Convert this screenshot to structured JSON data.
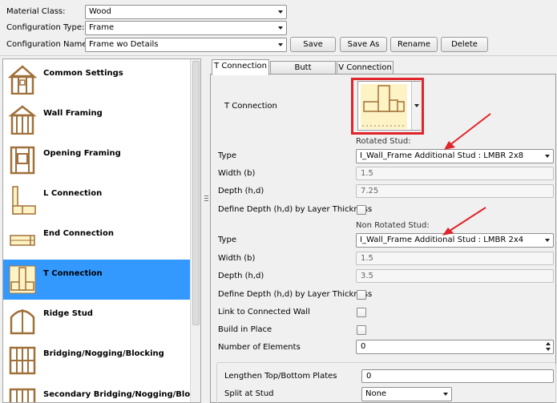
{
  "config": {
    "material_class_label": "Material Class:",
    "material_class_value": "Wood",
    "configuration_type_label": "Configuration Type:",
    "configuration_type_value": "Frame",
    "configuration_name_label": "Configuration Name:",
    "configuration_name_value": "Frame wo Details",
    "save_label": "Save",
    "save_as_label": "Save As",
    "rename_label": "Rename",
    "delete_label": "Delete"
  },
  "sidebar": {
    "items": [
      {
        "label": "Common Settings",
        "icon": "common-settings-icon"
      },
      {
        "label": "Wall Framing",
        "icon": "wall-framing-icon"
      },
      {
        "label": "Opening Framing",
        "icon": "opening-framing-icon"
      },
      {
        "label": "L Connection",
        "icon": "l-connection-icon"
      },
      {
        "label": "End Connection",
        "icon": "end-connection-icon"
      },
      {
        "label": "T Connection",
        "icon": "t-connection-icon",
        "selected": true
      },
      {
        "label": "Ridge Stud",
        "icon": "ridge-stud-icon"
      },
      {
        "label": "Bridging/Nogging/Blocking",
        "icon": "bridging-icon"
      },
      {
        "label": "Secondary Bridging/Nogging/Blocking",
        "icon": "secondary-bridging-icon"
      }
    ]
  },
  "tabs": [
    "T Connection",
    "Butt Connection",
    "V Connection"
  ],
  "panel": {
    "t_connection_label": "T Connection",
    "rotated_stud_heading": "Rotated Stud:",
    "rotated": {
      "type_label": "Type",
      "type_value": "I_Wall_Frame Additional Stud : LMBR 2x8",
      "width_label": "Width (b)",
      "width_value": "1.5",
      "depth_label": "Depth (h,d)",
      "depth_value": "7.25",
      "define_depth_label": "Define Depth (h,d) by Layer Thickness"
    },
    "non_rotated_stud_heading": "Non Rotated Stud:",
    "non_rotated": {
      "type_label": "Type",
      "type_value": "I_Wall_Frame Additional Stud : LMBR 2x4",
      "width_label": "Width (b)",
      "width_value": "1.5",
      "depth_label": "Depth (h,d)",
      "depth_value": "3.5",
      "define_depth_label": "Define Depth (h,d) by Layer Thickness"
    },
    "link_label": "Link to Connected Wall",
    "build_in_place_label": "Build in Place",
    "number_of_elements_label": "Number of Elements",
    "number_of_elements_value": "0",
    "lengthen_label": "Lengthen Top/Bottom Plates",
    "lengthen_value": "0",
    "split_at_stud_label": "Split at Stud",
    "split_at_stud_value": "None"
  },
  "colors": {
    "selection": "#3399ff",
    "highlight_box": "#e0242a",
    "arrow": "#e0242a",
    "wood": "#a0703a",
    "connection_fill": "#fdf3c4"
  }
}
